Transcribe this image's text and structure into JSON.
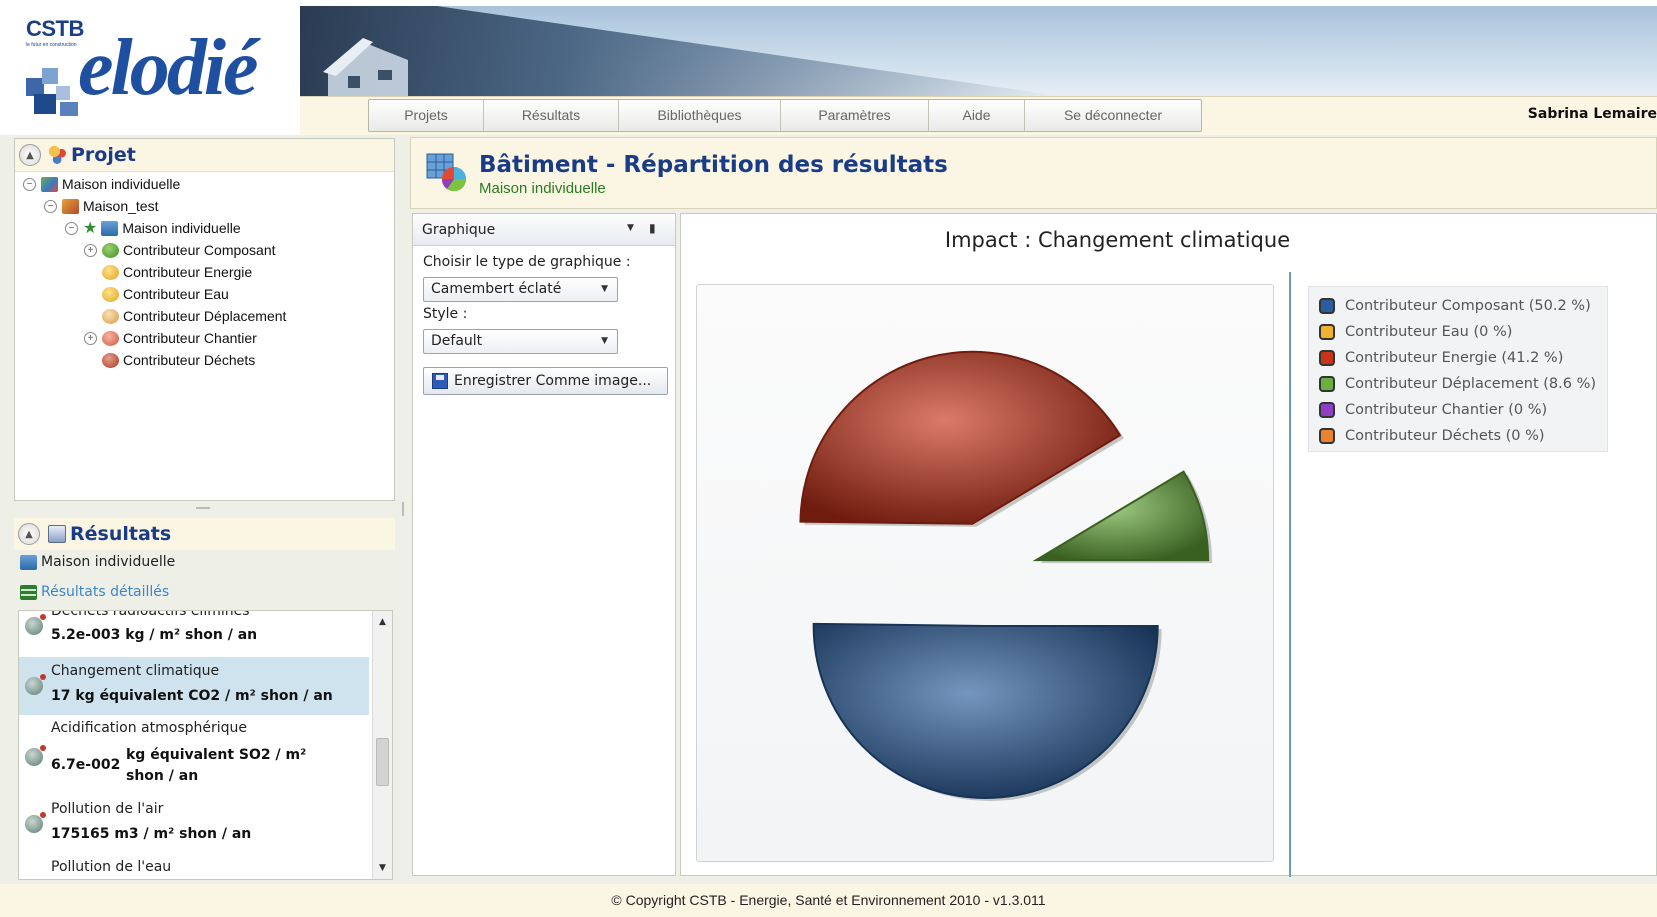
{
  "app": {
    "logo_brand": "CSTB",
    "logo_tagline": "le futur en construction",
    "logo_product": "elodié",
    "user_name": "Sabrina  Lemaire"
  },
  "nav": {
    "items": [
      "Projets",
      "Résultats",
      "Bibliothèques",
      "Paramètres",
      "Aide",
      "Se déconnecter"
    ]
  },
  "project_panel": {
    "title": "Projet",
    "tree": [
      {
        "label": "Maison individuelle",
        "toggle": "−"
      },
      {
        "label": "Maison_test",
        "toggle": "−"
      },
      {
        "label": "Maison individuelle",
        "toggle": "−",
        "starred": true
      },
      {
        "label": "Contributeur Composant",
        "toggle": "+"
      },
      {
        "label": "Contributeur Energie"
      },
      {
        "label": "Contributeur Eau"
      },
      {
        "label": "Contributeur Déplacement"
      },
      {
        "label": "Contributeur Chantier",
        "toggle": "+"
      },
      {
        "label": "Contributeur Déchets"
      }
    ]
  },
  "results_panel": {
    "title": "Résultats",
    "scope": "Maison individuelle",
    "detailed_link": "Résultats détaillés",
    "items": [
      {
        "name": "Déchets radioactifs éliminés",
        "value": "5.2e-003 kg / m² shon / an"
      },
      {
        "name": "Changement climatique",
        "value": "17 kg équivalent CO2 / m² shon / an",
        "selected": true
      },
      {
        "name": "Acidification atmosphérique",
        "value_num": "6.7e-002",
        "value_unit_1": "kg équivalent SO2 / m²",
        "value_unit_2": "shon / an"
      },
      {
        "name": "Pollution de l'air",
        "value": "175165 m3 / m² shon / an"
      },
      {
        "name": "Pollution de l'eau"
      }
    ]
  },
  "main": {
    "title": "Bâtiment - Répartition des résultats",
    "subtitle": "Maison individuelle"
  },
  "graph_panel": {
    "header": "Graphique",
    "type_label": "Choisir le type de graphique :",
    "type_value": "Camembert éclaté",
    "style_label": "Style :",
    "style_value": "Default",
    "save_label": "Enregistrer Comme image..."
  },
  "chart_data": {
    "type": "pie",
    "variant": "exploded",
    "title": "Impact : Changement climatique",
    "legend_position": "right",
    "slices": [
      {
        "label": "Contributeur Composant",
        "value": 50.2,
        "color": "#2a5d9c"
      },
      {
        "label": "Contributeur Eau",
        "value": 0,
        "color": "#f1b233"
      },
      {
        "label": "Contributeur Energie",
        "value": 41.2,
        "color": "#c9331a"
      },
      {
        "label": "Contributeur Déplacement",
        "value": 8.6,
        "color": "#6aae3c"
      },
      {
        "label": "Contributeur Chantier",
        "value": 0,
        "color": "#8e3fc4"
      },
      {
        "label": "Contributeur Déchets",
        "value": 0,
        "color": "#e8842d"
      }
    ],
    "legend": [
      "Contributeur Composant (50.2 %)",
      "Contributeur Eau (0 %)",
      "Contributeur Energie (41.2 %)",
      "Contributeur Déplacement (8.6 %)",
      "Contributeur Chantier (0 %)",
      "Contributeur Déchets (0 %)"
    ]
  },
  "footer": {
    "text": "© Copyright CSTB - Energie, Santé et Environnement 2010 - v1.3.011"
  }
}
